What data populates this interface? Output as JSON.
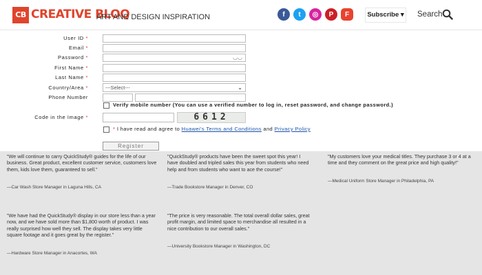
{
  "header": {
    "logo_mark": "CB",
    "logo_text": "CREATIVE BLOQ",
    "tagline": "ART AND DESIGN INSPIRATION",
    "social": [
      {
        "icon": "facebook-icon",
        "glyph": "f"
      },
      {
        "icon": "twitter-icon",
        "glyph": "t"
      },
      {
        "icon": "instagram-icon",
        "glyph": "◎"
      },
      {
        "icon": "pinterest-icon",
        "glyph": "P"
      },
      {
        "icon": "flipboard-icon",
        "glyph": "F"
      }
    ],
    "subscribe_label": "Subscribe ▾",
    "search_label": "Search"
  },
  "form": {
    "user_id_label": "User ID",
    "email_label": "Email",
    "password_label": "Password",
    "first_name_label": "First Name",
    "last_name_label": "Last Name",
    "country_label": "Country/Area",
    "country_value": "---Select---",
    "phone_label": "Phone Number",
    "verify_text": "Verify mobile number (You can use a verified number to log in, reset password, and change password.)",
    "captcha_label": "Code in the Image",
    "captcha_code": "6612",
    "agree_prefix": "I have read and agree to",
    "terms_link": "Huawei's Terms and Conditions",
    "agree_and": "and",
    "privacy_link": "Privacy Policy",
    "register_label": "Register",
    "required_mark": "*"
  },
  "testimonials": [
    {
      "quote": "\"We will continue to carry QuickStudy® guides for the life of our business. Great product, excellent customer service, customers love them, kids love them, guaranteed to sell.\"",
      "author": "—Car Wash Store Manager in Laguna Hills, CA"
    },
    {
      "quote": "\"QuickStudy® products have been the sweet spot this year! I have doubled and tripled sales this year from students who need help and from students who want to ace the course!\"",
      "author": "—Trade Bookstore Manager in Denver, CO"
    },
    {
      "quote": "\"My customers love your medical titles. They purchase 3 or 4 at a time and they comment on the great price and high quality!\"",
      "author": "—Medical Uniform Store Manager in Philadelphia, PA"
    },
    {
      "quote": "\"We have had the QuickStudy® display in our store less than a year now, and we have sold more than $1,800 worth of product. I was really surprised how well they sell. The display takes very little square footage and it goes great by the register.\"",
      "author": "—Hardware Store Manager in Anacortes, WA"
    },
    {
      "quote": "\"The price is very reasonable. The total overall dollar sales, great profit margin, and limited space to merchandise all resulted in a nice contribution to our overall sales.\"",
      "author": "—University Bookstore Manager in Washington, DC"
    }
  ],
  "colors": {
    "brand": "#e0442c",
    "testimonial_bg": "#e5e5e5",
    "link": "#1a52a8"
  }
}
